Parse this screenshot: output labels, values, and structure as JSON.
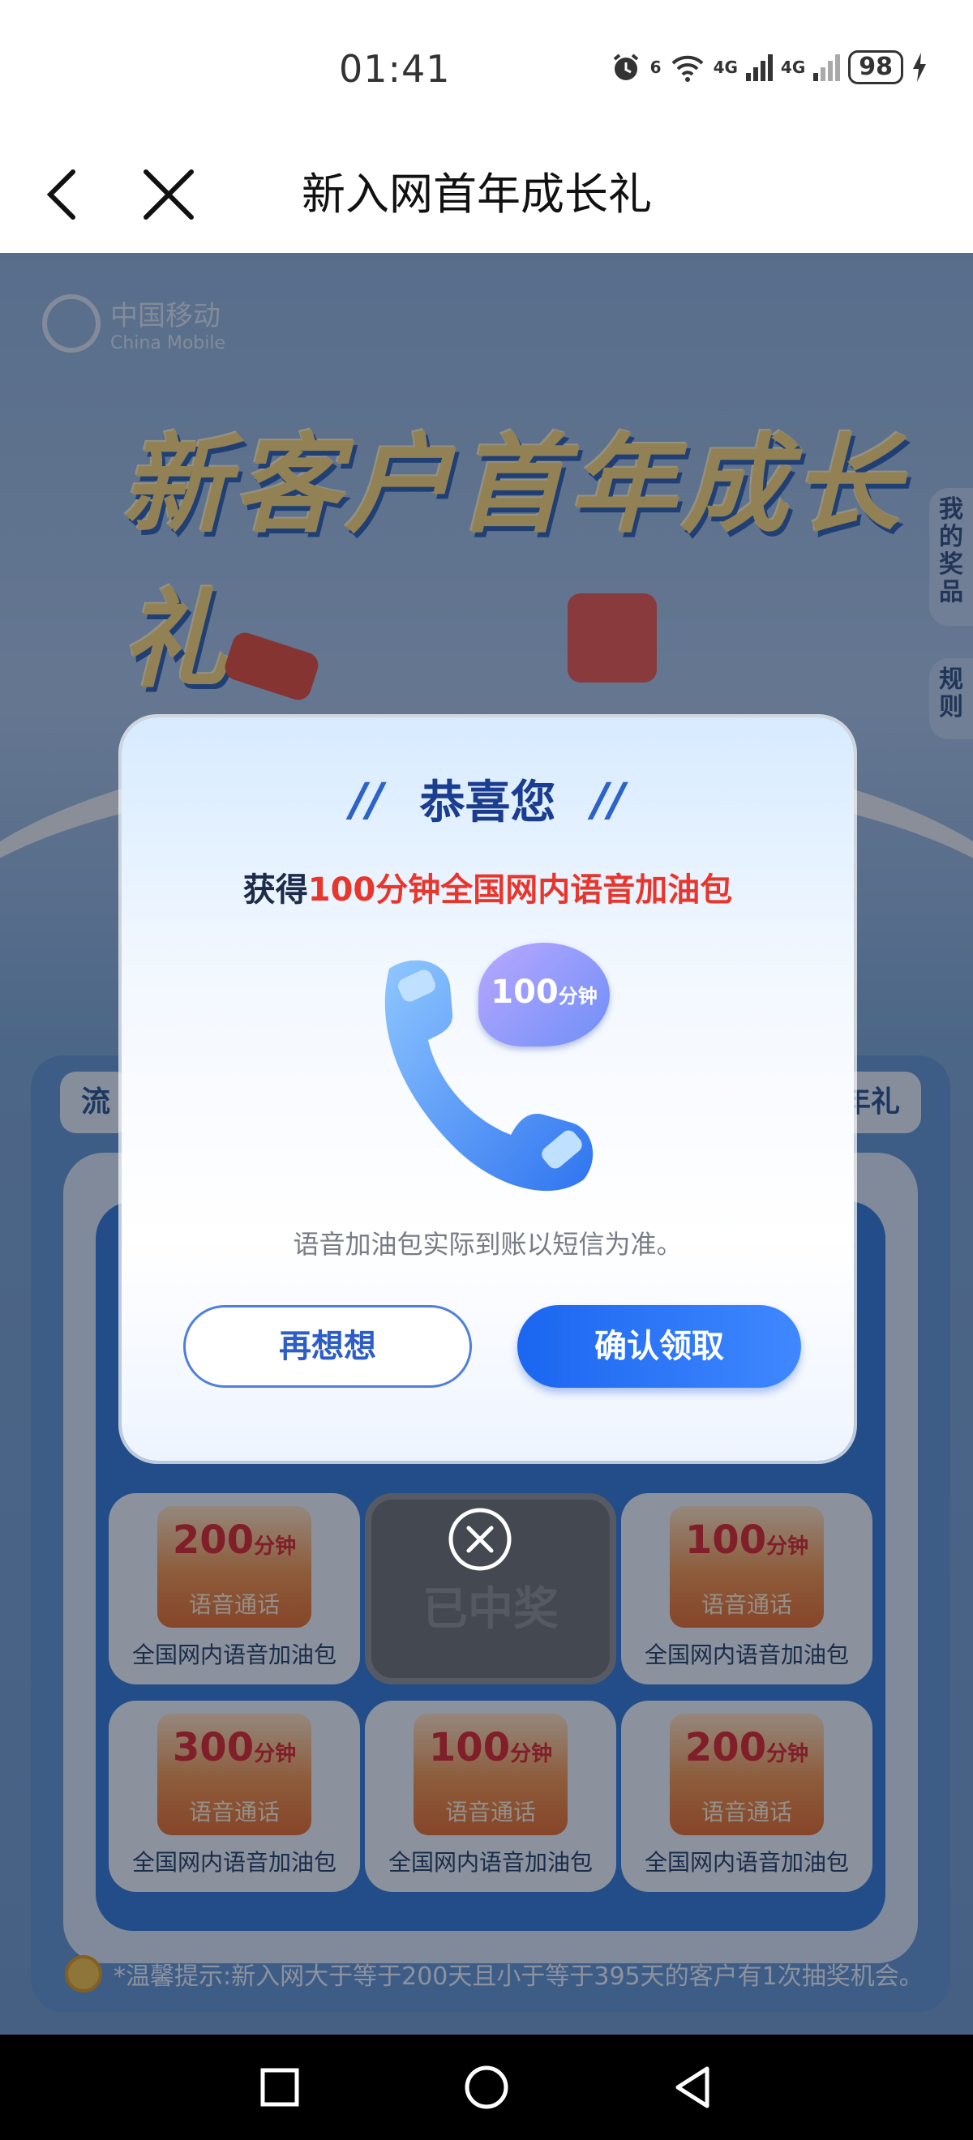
{
  "status_bar": {
    "time": "01:41",
    "net1": "6",
    "net2": "4G",
    "net3": "4G",
    "battery": "98"
  },
  "nav": {
    "title": "新入网首年成长礼"
  },
  "page": {
    "logo_cn": "中国移动",
    "logo_en": "China Mobile",
    "hero_title": "新客户首年成长礼",
    "side_prize": "我的奖品",
    "side_rules": "规则",
    "tab_left": "流",
    "tab_right": "年礼",
    "prizes": [
      {
        "amount": "200",
        "unit": "分钟",
        "tag": "语音通话",
        "name": "全国网内语音加油包"
      },
      {
        "won_text": "已中奖"
      },
      {
        "amount": "100",
        "unit": "分钟",
        "tag": "语音通话",
        "name": "全国网内语音加油包"
      },
      {
        "amount": "300",
        "unit": "分钟",
        "tag": "语音通话",
        "name": "全国网内语音加油包"
      },
      {
        "amount": "100",
        "unit": "分钟",
        "tag": "语音通话",
        "name": "全国网内语音加油包"
      },
      {
        "amount": "200",
        "unit": "分钟",
        "tag": "语音通话",
        "name": "全国网内语音加油包"
      }
    ],
    "tip": "*温馨提示:新入网大于等于200天且小于等于395天的客户有1次抽奖机会。"
  },
  "dialog": {
    "quote_left": "//",
    "quote_right": "//",
    "title": "恭喜您",
    "sub_prefix": "获得",
    "sub_highlight": "100分钟全国网内语音加油包",
    "bubble_amount": "100",
    "bubble_unit": "分钟",
    "note": "语音加油包实际到账以短信为准。",
    "secondary_button": "再想想",
    "primary_button": "确认领取"
  },
  "colors": {
    "primary": "#1b66f0",
    "highlight": "#e8362c",
    "title": "#1b3d8f"
  }
}
